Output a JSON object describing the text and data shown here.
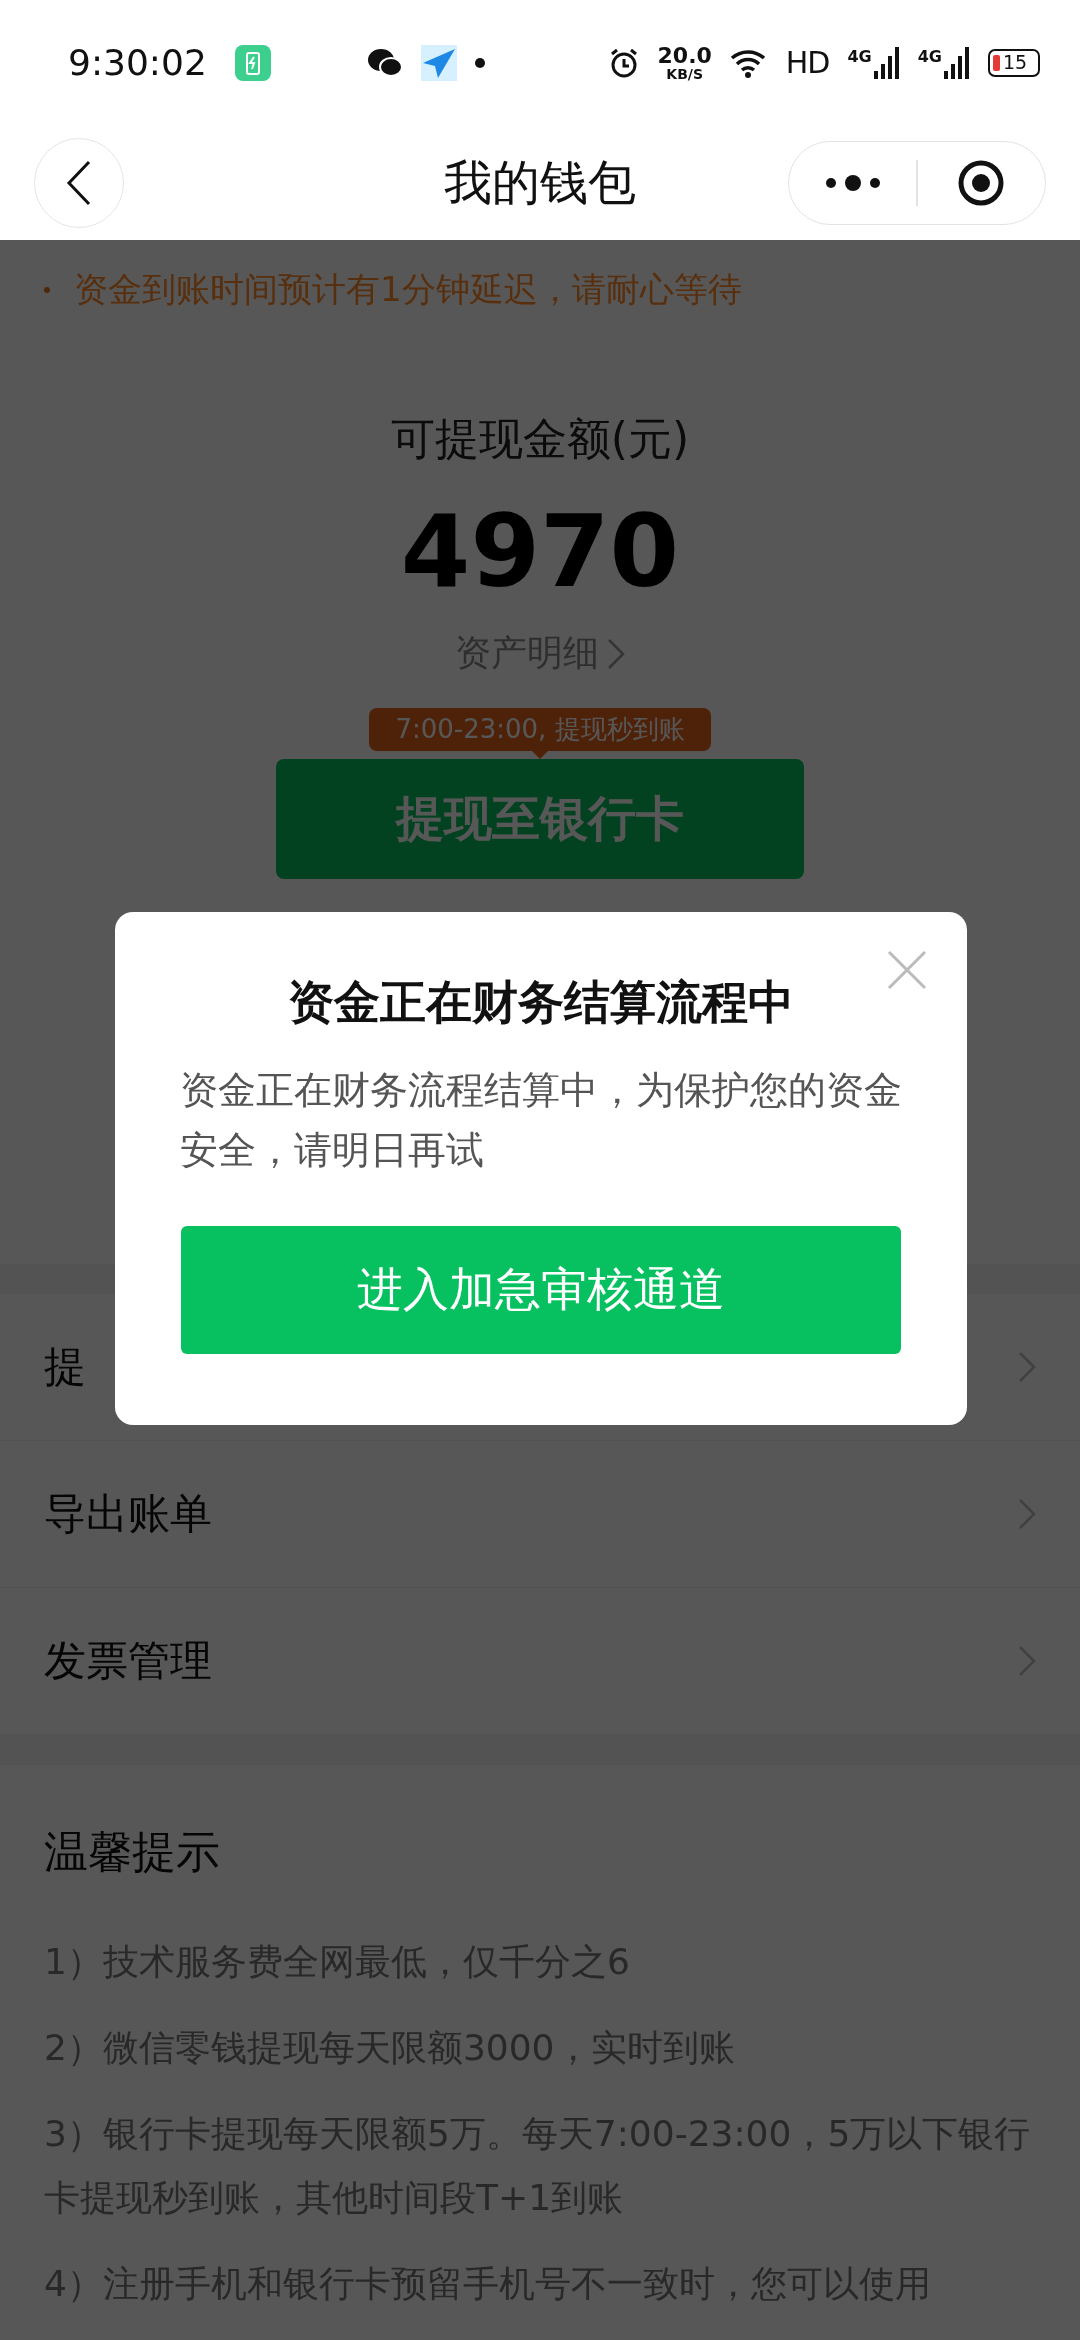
{
  "status_bar": {
    "time": "9:30:02",
    "net_speed_value": "20.0",
    "net_speed_unit": "KB/S",
    "hd": "HD",
    "signals": [
      "4G",
      "4G"
    ],
    "battery": "15"
  },
  "nav": {
    "title": "我的钱包"
  },
  "notice": "资金到账时间预计有1分钟延迟，请耐心等待",
  "balance": {
    "label": "可提现金额(元)",
    "amount": "4970",
    "detail_link": "资产明细"
  },
  "withdraw": {
    "tooltip": "7:00-23:00, 提现秒到账",
    "button": "提现至银行卡"
  },
  "menu": [
    {
      "label": "提"
    },
    {
      "label": "导出账单"
    },
    {
      "label": "发票管理"
    }
  ],
  "tips": {
    "title": "温馨提示",
    "items": [
      "1）技术服务费全网最低，仅千分之6",
      "2）微信零钱提现每天限额3000，实时到账",
      "3）银行卡提现每天限额5万。每天7:00-23:00，5万以下银行卡提现秒到账，其他时间段T+1到账",
      "4）注册手机和银行卡预留手机号不一致时，您可以使用"
    ]
  },
  "dialog": {
    "title": "资金正在财务结算流程中",
    "message": "资金正在财务流程结算中，为保护您的资金安全，请明日再试",
    "button": "进入加急审核通道"
  }
}
